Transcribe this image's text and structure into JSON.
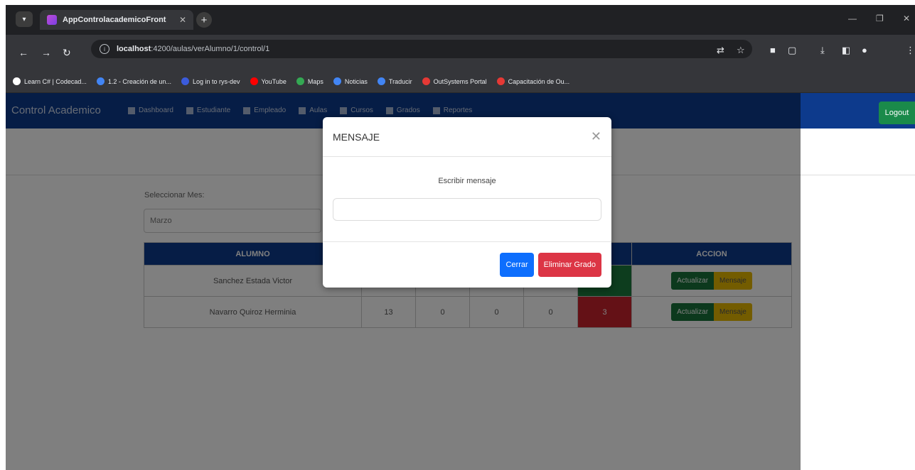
{
  "browser": {
    "tab_title": "AppControlacademicoFront",
    "url_host": "localhost",
    "url_path": ":4200/aulas/verAlumno/1/control/1",
    "bookmarks": [
      {
        "label": "Learn C# | Codecad...",
        "color": "#ffffff"
      },
      {
        "label": "1.2 - Creación de un...",
        "color": "#4285f4"
      },
      {
        "label": "Log in to rys-dev",
        "color": "#3b5bdb"
      },
      {
        "label": "YouTube",
        "color": "#ff0000"
      },
      {
        "label": "Maps",
        "color": "#34a853"
      },
      {
        "label": "Noticias",
        "color": "#4285f4"
      },
      {
        "label": "Traducir",
        "color": "#4285f4"
      },
      {
        "label": "OutSystems Portal",
        "color": "#e53935"
      },
      {
        "label": "Capacitación de Ou...",
        "color": "#e53935"
      }
    ]
  },
  "navbar": {
    "brand": "Control Academico",
    "links": [
      "Dashboard",
      "Estudiante",
      "Empleado",
      "Aulas",
      "Cursos",
      "Grados",
      "Reportes"
    ],
    "logout": "Logout"
  },
  "filter": {
    "label": "Seleccionar Mes:",
    "selected": "Marzo"
  },
  "table": {
    "headers": [
      "ALUMNO",
      "",
      "",
      "",
      "",
      "",
      "ACCION"
    ],
    "rows": [
      {
        "name": "Sanchez Estada Victor",
        "c1": "",
        "c2": "",
        "c3": "",
        "c4": "",
        "c5": ""
      },
      {
        "name": "Navarro Quiroz Herminia",
        "c1": "13",
        "c2": "0",
        "c3": "0",
        "c4": "0",
        "c5": "3"
      }
    ],
    "btn_update": "Actualizar",
    "btn_message": "Mensaje"
  },
  "modal": {
    "title": "MENSAJE",
    "prompt": "Escribir mensaje",
    "input_value": "",
    "btn_close": "Cerrar",
    "btn_delete": "Eliminar Grado"
  }
}
